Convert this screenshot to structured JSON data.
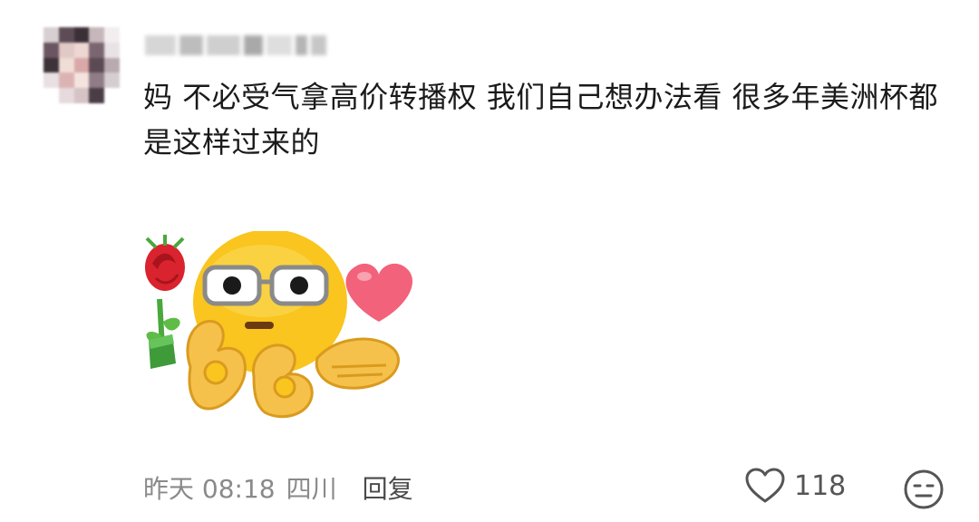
{
  "comment": {
    "text": "妈 不必受气拿高价转播权 我们自己想办法看 很多年美洲杯都是这样过来的"
  },
  "meta": {
    "time": "昨天 08:18",
    "location": "四川",
    "reply_label": "回复"
  },
  "actions": {
    "like_count": "118",
    "like_icon": "heart-outline-icon",
    "face_icon": "neutral-face-icon"
  },
  "sticker": {
    "icon": "emoji-sticker-rose-heart-glasses-face"
  },
  "colors": {
    "text": "#1a1a1a",
    "meta": "#8a8a8a",
    "emoji_yellow": "#f9c51e",
    "heart": "#f2627a",
    "rose": "#d9232e"
  }
}
